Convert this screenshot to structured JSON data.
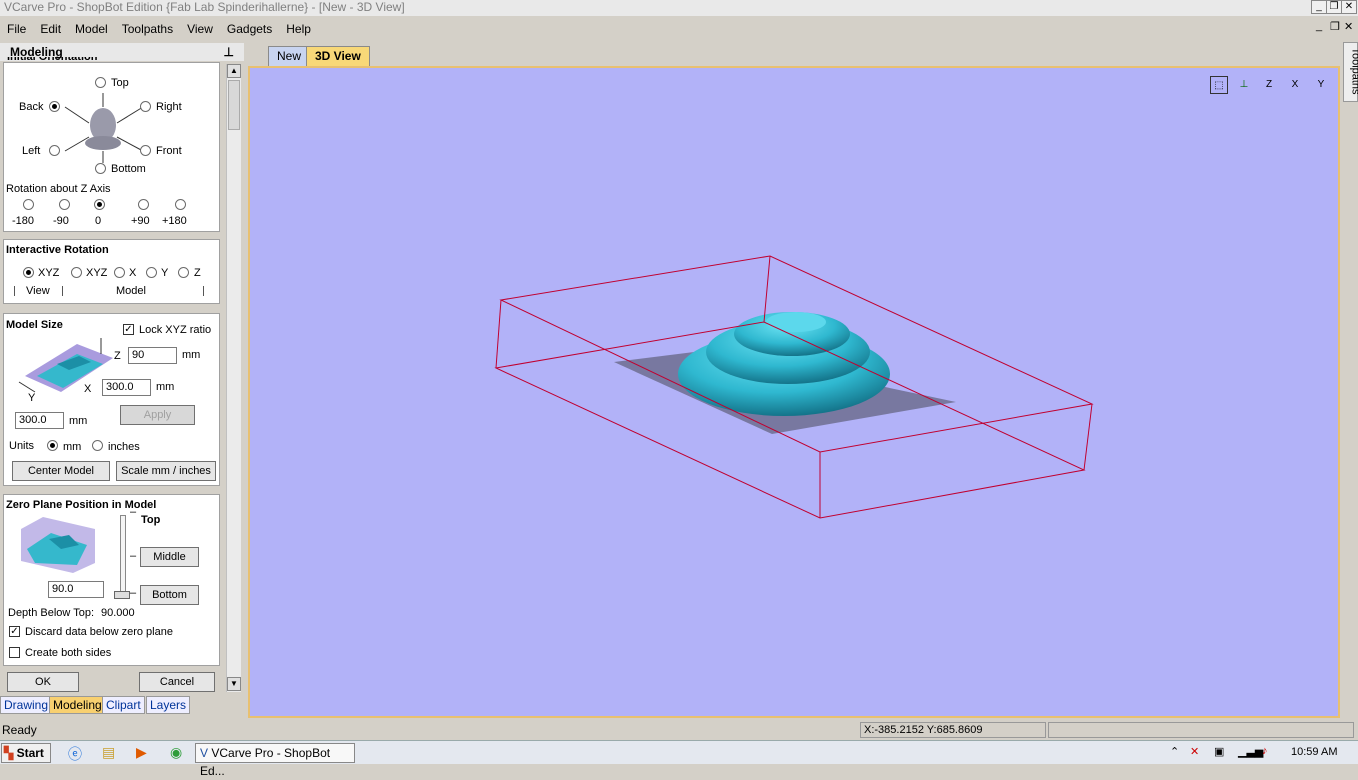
{
  "window": {
    "title": "VCarve Pro - ShopBot Edition {Fab Lab Spinderihallerne} - [New - 3D View]"
  },
  "menu": [
    "File",
    "Edit",
    "Model",
    "Toolpaths",
    "View",
    "Gadgets",
    "Help"
  ],
  "panel": {
    "title": "Modeling",
    "pin_icon": "pin-icon",
    "initial_orientation": {
      "heading": "Initial Orientation",
      "options": [
        "Top",
        "Back",
        "Right",
        "Left",
        "Front",
        "Bottom"
      ],
      "selected": "Back",
      "rotation_label": "Rotation about Z Axis",
      "rotation_options": [
        "-180",
        "-90",
        "0",
        "+90",
        "+180"
      ],
      "rotation_selected": "0"
    },
    "interactive_rotation": {
      "heading": "Interactive Rotation",
      "options": [
        "XYZ",
        "XYZ",
        "X",
        "Y",
        "Z"
      ],
      "view_label": "View",
      "model_label": "Model"
    },
    "model_size": {
      "heading": "Model Size",
      "lock_label": "Lock XYZ ratio",
      "z_label": "Z",
      "z_value": "90",
      "z_unit": "mm",
      "x_label": "X",
      "x_value": "300.0",
      "x_unit": "mm",
      "y_label": "Y",
      "y_value": "300.0",
      "y_unit": "mm",
      "apply_label": "Apply",
      "units_label": "Units",
      "units_mm": "mm",
      "units_inches": "inches",
      "center_label": "Center Model",
      "scale_label": "Scale mm / inches"
    },
    "zero_plane": {
      "heading": "Zero Plane Position in Model",
      "top_label": "Top",
      "middle_label": "Middle",
      "bottom_label": "Bottom",
      "value": "90.0",
      "depth_label": "Depth Below Top:",
      "depth_value": "90.000",
      "discard_label": "Discard data below zero plane",
      "both_sides_label": "Create both sides"
    },
    "ok_label": "OK",
    "cancel_label": "Cancel",
    "bottom_tabs": [
      "Drawing",
      "Modeling",
      "Clipart",
      "Layers"
    ]
  },
  "view": {
    "tabs": [
      "New",
      "3D View"
    ],
    "icons": [
      "zoom-extents-icon",
      "iso-view-icon",
      "z-view-icon",
      "x-view-icon",
      "y-view-icon"
    ],
    "icon_labels": [
      "",
      "",
      "Z",
      "X",
      "Y"
    ]
  },
  "right_tab": "Toolpaths",
  "status": {
    "text": "Ready",
    "coords": "X:-385.2152 Y:685.8609"
  },
  "taskbar": {
    "start": "Start",
    "app_button": "VCarve Pro - ShopBot Ed...",
    "clock": "10:59 AM"
  }
}
